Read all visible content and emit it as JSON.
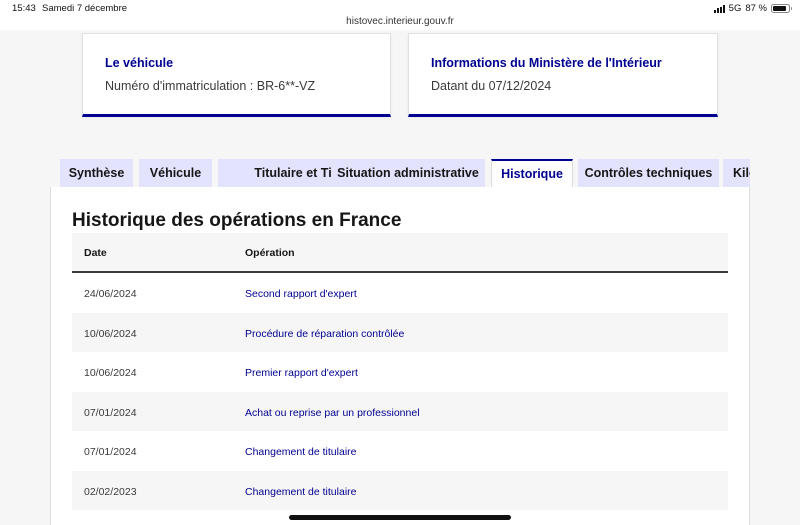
{
  "status_bar": {
    "time": "15:43",
    "date": "Samedi 7 décembre",
    "url": "histovec.interieur.gouv.fr",
    "network": "5G",
    "battery": "87 %",
    "battery_level": 0.87
  },
  "cards": {
    "vehicle": {
      "title": "Le véhicule",
      "text": "Numéro d'immatriculation : BR-6**-VZ"
    },
    "ministry": {
      "title": "Informations du Ministère de l'Intérieur",
      "text": "Datant du 07/12/2024"
    }
  },
  "tabs": [
    {
      "label": "Synthèse"
    },
    {
      "label": "Véhicule"
    },
    {
      "label": "Titulaire et Titre"
    },
    {
      "label": "Situation administrative"
    },
    {
      "label": "Historique"
    },
    {
      "label": "Contrôles techniques"
    },
    {
      "label": "Kilométrage"
    }
  ],
  "history": {
    "title": "Historique des opérations en France",
    "columns": {
      "date": "Date",
      "operation": "Opération"
    },
    "rows": [
      {
        "date": "24/06/2024",
        "operation": "Second rapport d'expert"
      },
      {
        "date": "10/06/2024",
        "operation": "Procédure de réparation contrôlée"
      },
      {
        "date": "10/06/2024",
        "operation": "Premier rapport d'expert"
      },
      {
        "date": "07/01/2024",
        "operation": "Achat ou reprise par un professionnel"
      },
      {
        "date": "07/01/2024",
        "operation": "Changement de titulaire"
      },
      {
        "date": "02/02/2023",
        "operation": "Changement de titulaire"
      },
      {
        "date": "",
        "operation": ""
      }
    ]
  },
  "colors": {
    "accent": "#000091",
    "tab_background": "#e3e3fd",
    "row_alt": "#f6f6f6"
  }
}
